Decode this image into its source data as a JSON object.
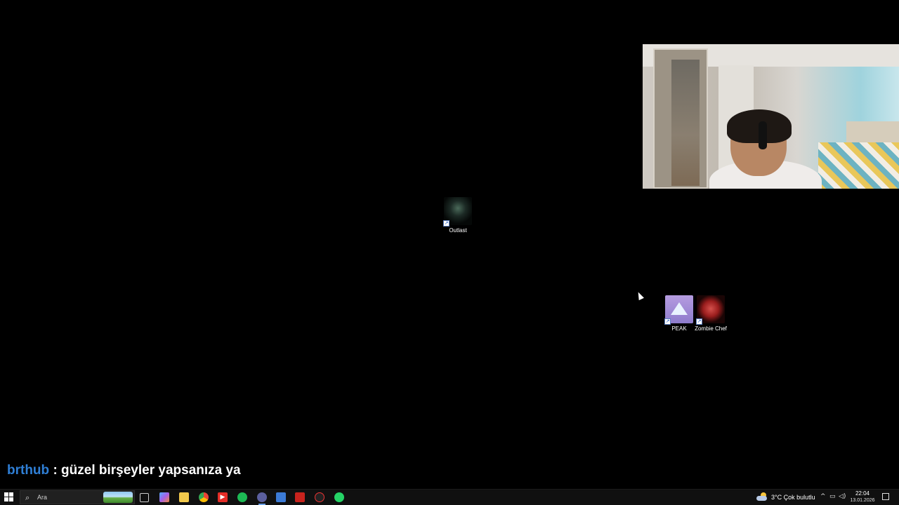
{
  "desktop": {
    "icons": [
      {
        "label": "Outlast",
        "icon": "outlast-game-icon"
      },
      {
        "label": "PEAK",
        "icon": "peak-game-icon"
      },
      {
        "label": "Zombie Chef",
        "icon": "zombie-chef-game-icon"
      }
    ]
  },
  "chat": {
    "username": "brthub",
    "separator": ":",
    "message": "güzel birşeyler yapsanıza ya",
    "username_color": "#2f7fd6"
  },
  "taskbar": {
    "search_placeholder": "Ara",
    "apps": [
      {
        "name": "task-view",
        "icon": "task-view-icon"
      },
      {
        "name": "copilot",
        "icon": "copilot-icon"
      },
      {
        "name": "file-explorer",
        "icon": "folder-icon"
      },
      {
        "name": "chrome",
        "icon": "chrome-icon"
      },
      {
        "name": "youtube",
        "icon": "youtube-icon"
      },
      {
        "name": "spotify",
        "icon": "spotify-icon"
      },
      {
        "name": "obs",
        "icon": "obs-icon",
        "active": true
      },
      {
        "name": "app-blue",
        "icon": "settings-app-icon"
      },
      {
        "name": "app-red",
        "icon": "red-app-icon"
      },
      {
        "name": "app-recorder",
        "icon": "recorder-icon"
      },
      {
        "name": "whatsapp",
        "icon": "whatsapp-icon"
      }
    ],
    "weather": {
      "temp": "3°C",
      "condition": "Çok bulutlu"
    },
    "clock": {
      "time": "22:04",
      "date": "13.01.2026"
    }
  }
}
